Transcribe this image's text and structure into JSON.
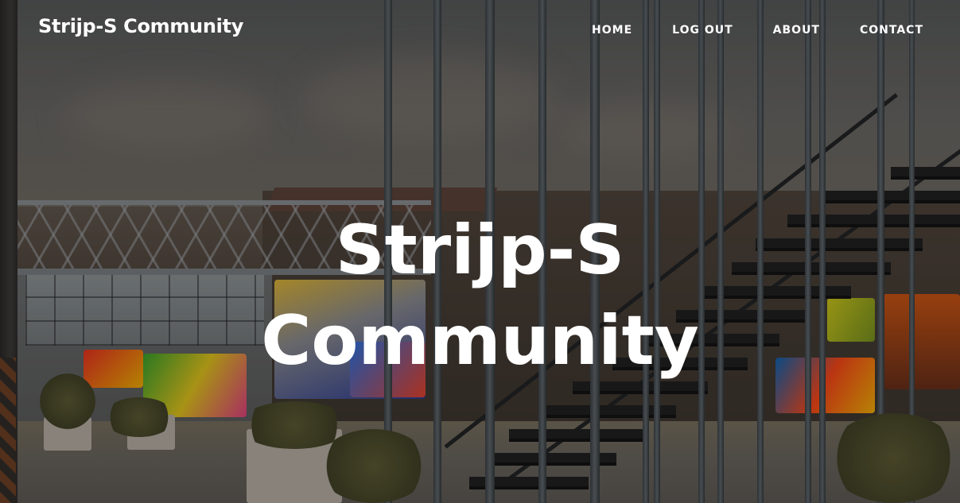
{
  "navbar": {
    "brand": "Strijp-S Community",
    "links": [
      {
        "label": "HOME"
      },
      {
        "label": "LOG OUT"
      },
      {
        "label": "ABOUT"
      },
      {
        "label": "CONTACT"
      }
    ]
  },
  "hero": {
    "heading_line1": "Strijp-S",
    "heading_line2": "Community",
    "background_image": "industrial-courtyard-with-metal-staircase-and-graffiti"
  },
  "colors": {
    "text": "#ffffff",
    "overlay": "#0f0c0a"
  }
}
